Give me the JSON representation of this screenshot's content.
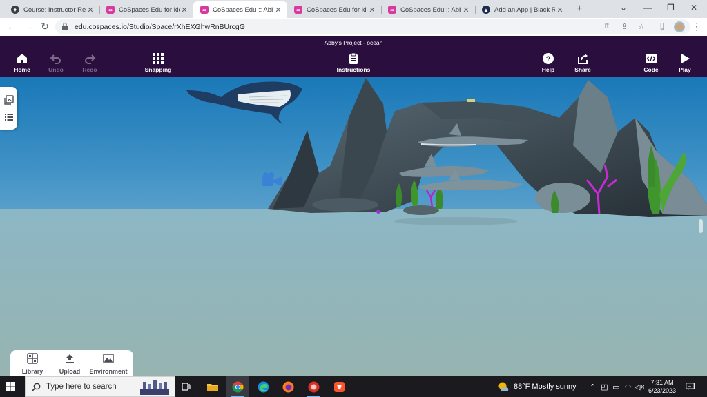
{
  "browser": {
    "tabs": [
      {
        "title": "Course: Instructor Res",
        "favicon": "compass-icon",
        "active": false
      },
      {
        "title": "CoSpaces Edu for kids",
        "favicon": "cospaces-icon",
        "active": false
      },
      {
        "title": "CoSpaces Edu :: Abby's",
        "favicon": "cospaces-icon",
        "active": true
      },
      {
        "title": "CoSpaces Edu for kids",
        "favicon": "cospaces-icon",
        "active": false
      },
      {
        "title": "CoSpaces Edu :: Abby's",
        "favicon": "cospaces-icon",
        "active": false
      },
      {
        "title": "Add an App | Black Ro",
        "favicon": "blackrocket-icon",
        "active": false
      }
    ],
    "url": "edu.cospaces.io/Studio/Space/rXhEXGhwRnBUrcgG"
  },
  "app": {
    "project_title": "Abby's Project - ocean",
    "buttons": {
      "home": "Home",
      "undo": "Undo",
      "redo": "Redo",
      "snapping": "Snapping",
      "instructions": "Instructions",
      "help": "Help",
      "share": "Share",
      "code": "Code",
      "play": "Play"
    },
    "bottom": {
      "library": "Library",
      "upload": "Upload",
      "environment": "Environment"
    },
    "accent": "#2a0f3e"
  },
  "taskbar": {
    "search_placeholder": "Type here to search",
    "weather": "88°F  Mostly sunny",
    "time": "7:31 AM",
    "date": "6/23/2023"
  }
}
